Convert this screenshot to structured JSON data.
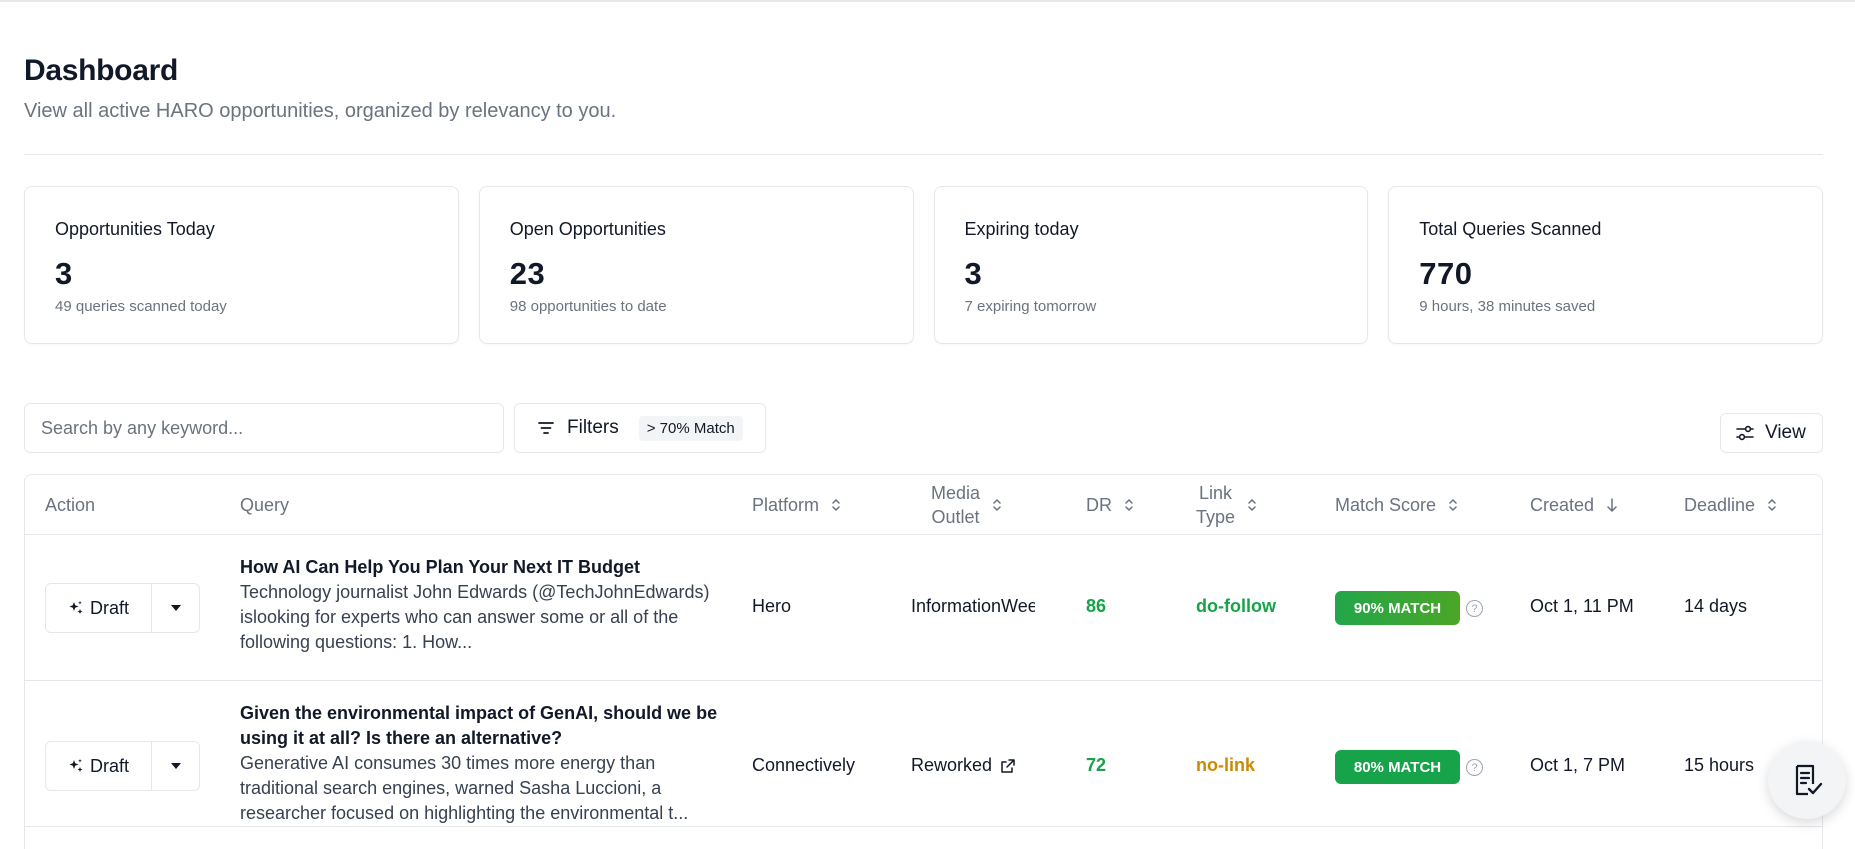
{
  "header": {
    "title": "Dashboard",
    "subtitle": "View all active HARO opportunities, organized by relevancy to you."
  },
  "stats": [
    {
      "label": "Opportunities Today",
      "value": "3",
      "sub": "49 queries scanned today"
    },
    {
      "label": "Open Opportunities",
      "value": "23",
      "sub": "98 opportunities to date"
    },
    {
      "label": "Expiring today",
      "value": "3",
      "sub": "7 expiring tomorrow"
    },
    {
      "label": "Total Queries Scanned",
      "value": "770",
      "sub": "9 hours, 38 minutes saved"
    }
  ],
  "toolbar": {
    "search_placeholder": "Search by any keyword...",
    "filters_label": "Filters",
    "filters_badge": "> 70% Match",
    "view_label": "View"
  },
  "table": {
    "columns": {
      "action": "Action",
      "query": "Query",
      "platform": "Platform",
      "media_outlet_line1": "Media",
      "media_outlet_line2": "Outlet",
      "dr": "DR",
      "link_type_line1": "Link",
      "link_type_line2": "Type",
      "match_score": "Match Score",
      "created": "Created",
      "deadline": "Deadline"
    },
    "rows": [
      {
        "draft_label": "Draft",
        "query_title": "How AI Can Help You Plan Your Next IT Budget",
        "query_body": "Technology journalist John Edwards (@TechJohnEdwards) islooking for experts who can answer some or all of the following questions: 1. How...",
        "platform": "Hero",
        "media_outlet": "InformationWeek",
        "dr": "86",
        "link_type": "do-follow",
        "match": "90% MATCH",
        "help": "?",
        "created": "Oct 1, 11 PM",
        "deadline": "14 days"
      },
      {
        "draft_label": "Draft",
        "query_title": "Given the environmental impact of GenAI, should we be using it at all? Is there an alternative?",
        "query_body": "Generative AI consumes 30 times more energy than traditional search engines, warned Sasha Luccioni, a researcher focused on highlighting the environmental t...",
        "platform": "Connectively",
        "media_outlet": "Reworked",
        "dr": "72",
        "link_type": "no-link",
        "match": "80% MATCH",
        "help": "?",
        "created": "Oct 1, 7 PM",
        "deadline": "15 hours"
      }
    ]
  },
  "colors": {
    "match_90": "#22a64a",
    "match_80": "#16a34a",
    "dofollow": "#16a34a",
    "nolink": "#ca8a04"
  },
  "icons": {
    "filter": "filter-lines-icon",
    "view": "sliders-icon",
    "draft": "sparkles-icon",
    "caret": "caret-down-icon",
    "external": "external-link-icon",
    "fab": "clipboard-check-icon"
  }
}
